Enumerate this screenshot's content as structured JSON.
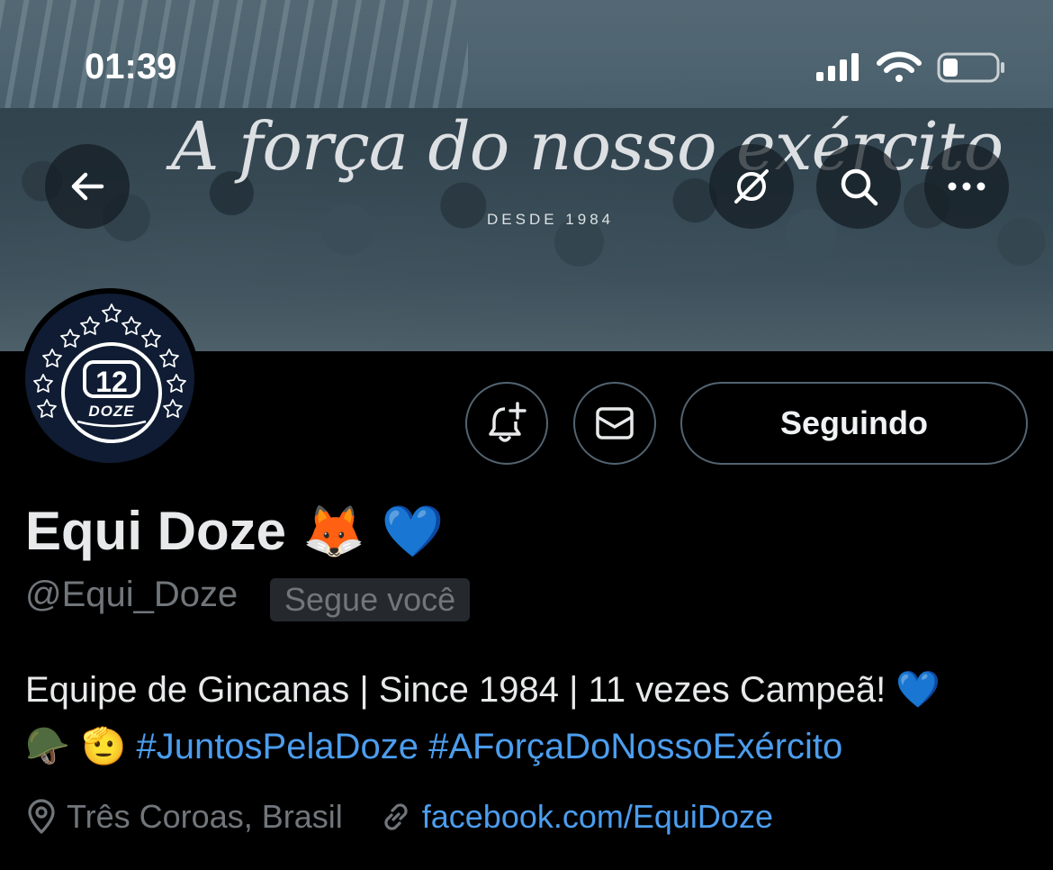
{
  "status_bar": {
    "time": "01:39"
  },
  "banner": {
    "slogan": "A força do nosso exército",
    "since": "DESDE 1984"
  },
  "header_buttons": {
    "back_icon": "arrow-left-icon",
    "grok_icon": "grok-icon",
    "search_icon": "search-icon",
    "more_icon": "more-horizontal-icon"
  },
  "avatar": {
    "number": "12",
    "word": "DOZE"
  },
  "actions": {
    "notify_icon": "bell-plus-icon",
    "message_icon": "envelope-icon",
    "follow_label": "Seguindo"
  },
  "profile": {
    "display_name": "Equi Doze",
    "name_emoji": "🦊 💙",
    "handle": "@Equi_Doze",
    "follows_you": "Segue você",
    "bio_line1": "Equipe de Gincanas | Since 1984 | 11 vezes Campeã! 💙",
    "bio_emoji": "🪖 🫡",
    "bio_hashtags": "#JuntosPelaDoze #AForçaDoNossoExército",
    "location": "Três Coroas, Brasil",
    "website": "facebook.com/EquiDoze"
  },
  "colors": {
    "background": "#000000",
    "text": "#e7e9ea",
    "secondary_text": "#71767b",
    "link": "#4c9ded",
    "border": "#536471"
  }
}
